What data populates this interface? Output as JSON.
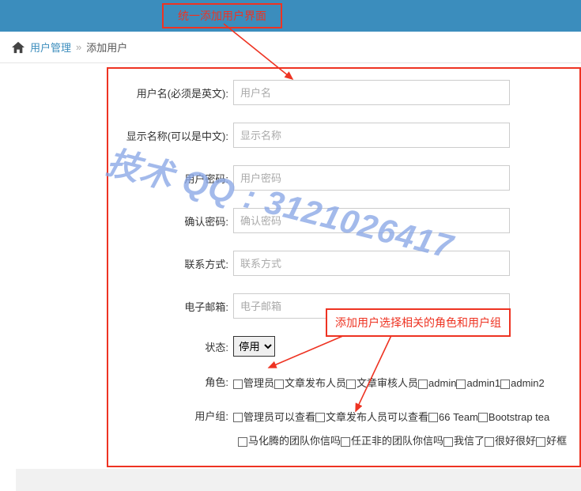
{
  "topCallout": "统一添加用户界面",
  "breadcrumb": {
    "link": "用户管理",
    "sep": "»",
    "current": "添加用户"
  },
  "fields": {
    "username": {
      "label": "用户名(必须是英文):",
      "placeholder": "用户名"
    },
    "displayname": {
      "label": "显示名称(可以是中文):",
      "placeholder": "显示名称"
    },
    "password": {
      "label": "用户密码:",
      "placeholder": "用户密码"
    },
    "confirm": {
      "label": "确认密码:",
      "placeholder": "确认密码"
    },
    "contact": {
      "label": "联系方式:",
      "placeholder": "联系方式"
    },
    "email": {
      "label": "电子邮箱:",
      "placeholder": "电子邮箱"
    },
    "status": {
      "label": "状态:",
      "selected": "停用"
    }
  },
  "roles": {
    "label": "角色:",
    "items": [
      "管理员",
      "文章发布人员",
      "文章审核人员",
      "admin",
      "admin1",
      "admin2"
    ]
  },
  "groups": {
    "label": "用户组:",
    "items": [
      "管理员可以查看",
      "文章发布人员可以查看",
      "66 Team",
      "Bootstrap tea"
    ],
    "extra": [
      "马化腾的团队你信吗",
      "任正非的团队你信吗",
      "我信了",
      "很好很好",
      "好框"
    ]
  },
  "midCallout": "添加用户选择相关的角色和用户组",
  "watermark": "技术 QQ : 3121026417"
}
